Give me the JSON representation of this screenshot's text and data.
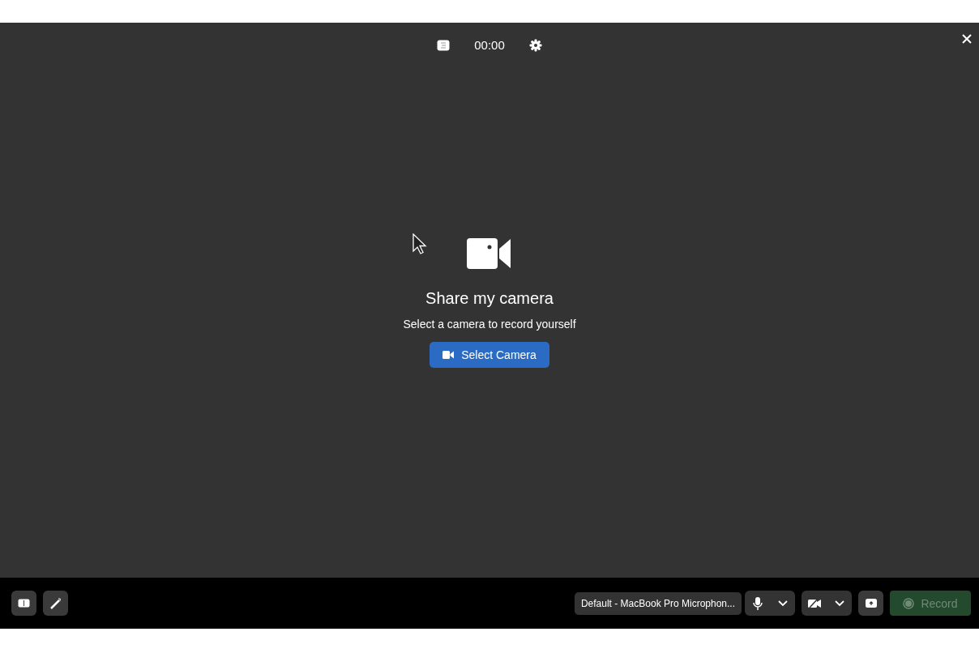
{
  "top_bar": {
    "timer": "00:00"
  },
  "prompt": {
    "title": "Share my camera",
    "subtitle": "Select a camera to record yourself",
    "button": "Select Camera"
  },
  "toolbar": {
    "microphone_label": "Default - MacBook Pro Microphon...",
    "camera_off": true,
    "record": {
      "label": "Record",
      "disabled": true
    }
  }
}
